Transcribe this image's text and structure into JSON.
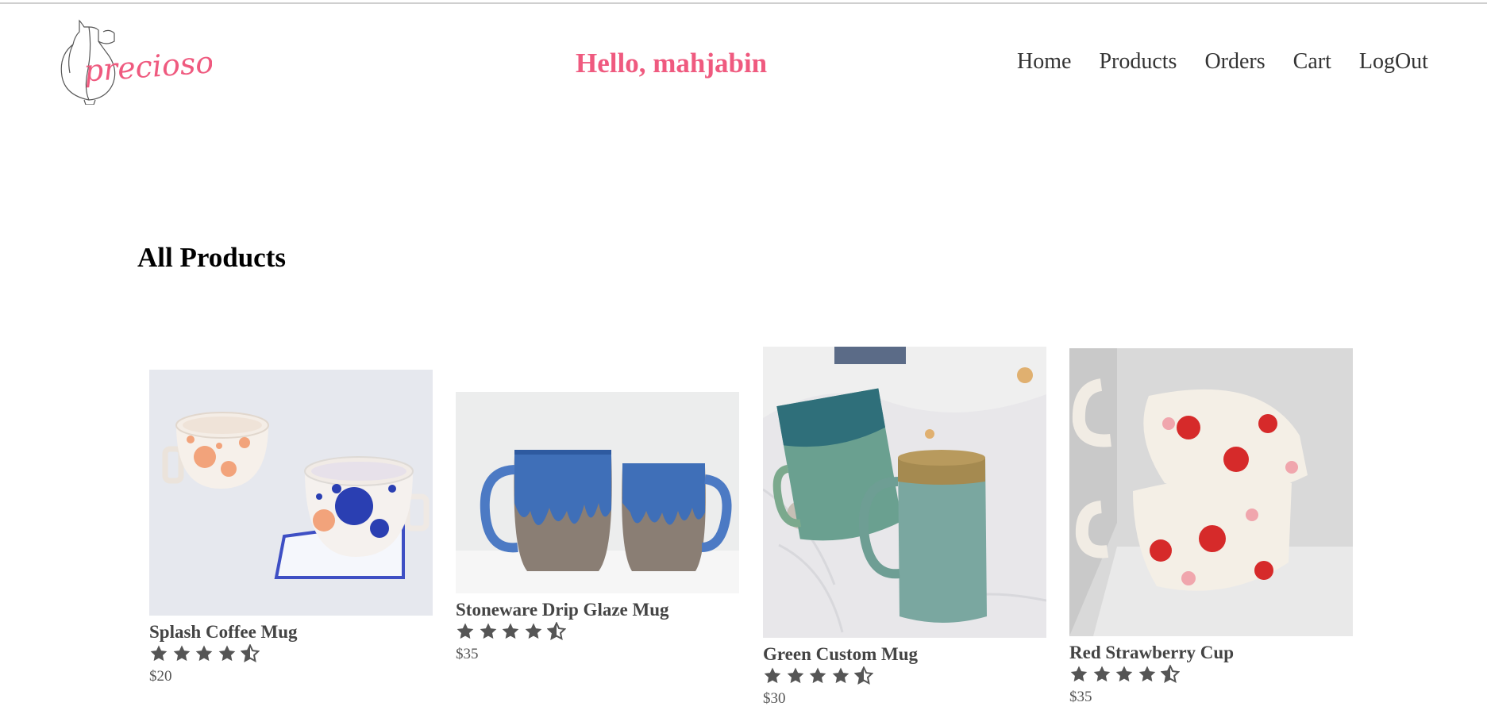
{
  "brand": {
    "logo_text": "precioso",
    "accent_color": "#ef5a7f"
  },
  "header": {
    "greeting": "Hello, mahjabin",
    "nav": [
      {
        "label": "Home",
        "icon": "none"
      },
      {
        "label": "Products",
        "icon": "none"
      },
      {
        "label": "Orders",
        "icon": "none"
      },
      {
        "label": "Cart",
        "icon": "none"
      },
      {
        "label": "LogOut",
        "icon": "none"
      }
    ]
  },
  "main": {
    "title": "All Products",
    "products": [
      {
        "name": "Splash Coffee Mug",
        "rating": 4.5,
        "price": "$20",
        "image": "splash-mugs-photo"
      },
      {
        "name": "Stoneware Drip Glaze Mug",
        "rating": 4.5,
        "price": "$35",
        "image": "drip-glaze-mugs-photo"
      },
      {
        "name": "Green Custom Mug",
        "rating": 4.5,
        "price": "$30",
        "image": "green-mugs-photo"
      },
      {
        "name": "Red Strawberry Cup",
        "rating": 4.5,
        "price": "$35",
        "image": "strawberry-cups-photo"
      }
    ]
  }
}
